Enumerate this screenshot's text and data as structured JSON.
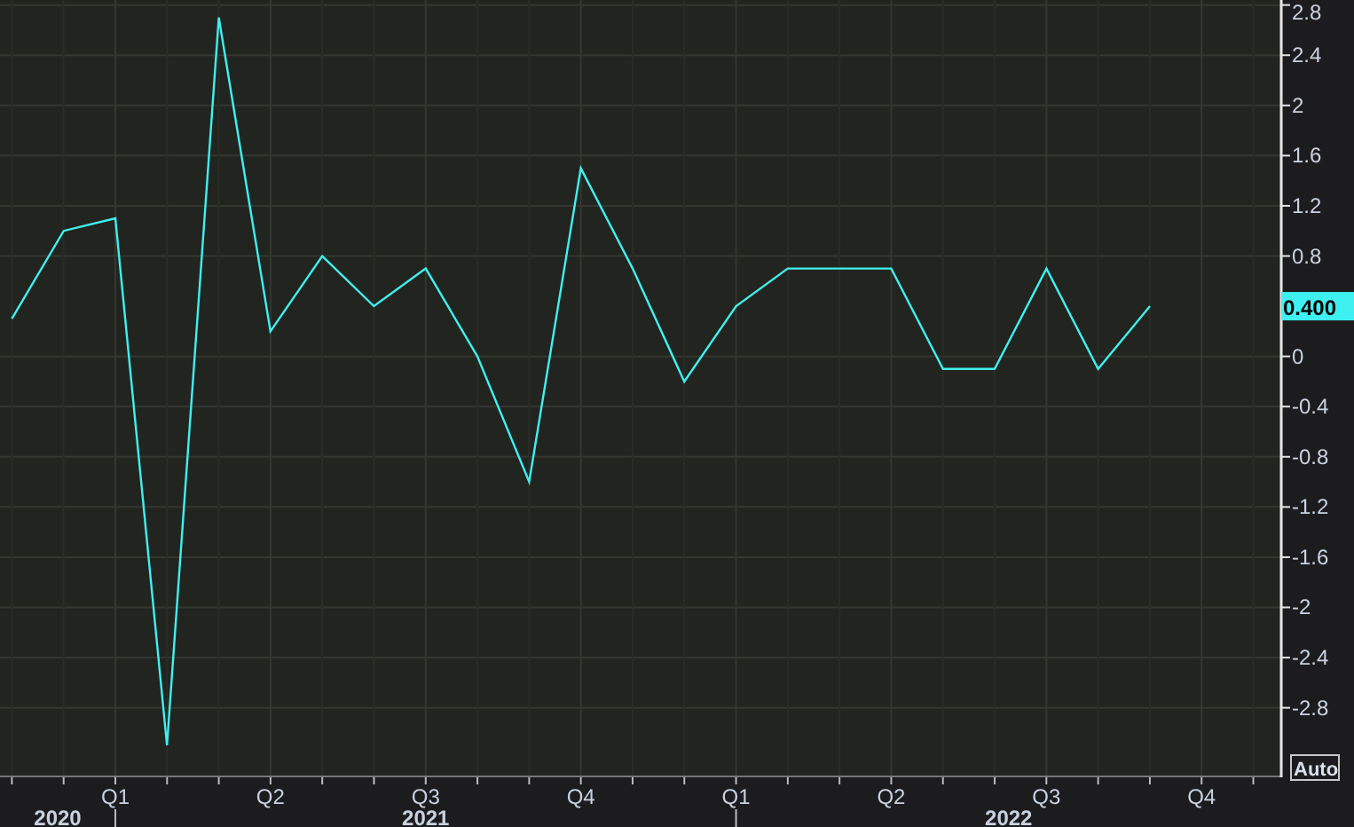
{
  "chart_data": {
    "type": "line",
    "categories": [
      null,
      null,
      "Q1",
      null,
      null,
      "Q2",
      null,
      null,
      "Q3",
      null,
      null,
      "Q4",
      null,
      null,
      "Q1",
      null,
      null,
      "Q2",
      null,
      null,
      "Q3",
      null,
      null,
      "Q4",
      null
    ],
    "series": [
      {
        "color": "#3ff0f0",
        "values": [
          0.3,
          1.0,
          1.1,
          -3.1,
          2.7,
          0.2,
          0.8,
          0.4,
          0.7,
          0.0,
          -1.0,
          1.5,
          0.7,
          -0.2,
          0.4,
          0.7,
          0.7,
          0.7,
          -0.1,
          -0.1,
          0.7,
          -0.1,
          0.4,
          null,
          null
        ]
      }
    ],
    "grid": true,
    "ylim": [
      -3.34,
      2.84
    ],
    "yticks": [
      {
        "value": 2.8,
        "label": "2.8"
      },
      {
        "value": 2.4,
        "label": "2.4"
      },
      {
        "value": 2,
        "label": "2"
      },
      {
        "value": 1.6,
        "label": "1.6"
      },
      {
        "value": 1.2,
        "label": "1.2"
      },
      {
        "value": 0.8,
        "label": "0.8"
      },
      {
        "value": 0,
        "label": "0"
      },
      {
        "value": -0.4,
        "label": "-0.4"
      },
      {
        "value": -0.8,
        "label": "-0.8"
      },
      {
        "value": -1.2,
        "label": "-1.2"
      },
      {
        "value": -1.6,
        "label": "-1.6"
      },
      {
        "value": -2,
        "label": "-2"
      },
      {
        "value": -2.4,
        "label": "-2.4"
      },
      {
        "value": -2.8,
        "label": "-2.8"
      }
    ]
  },
  "years": [
    {
      "label": "2020"
    },
    {
      "label": "2021"
    },
    {
      "label": "2022"
    }
  ],
  "current_value": {
    "label": "0.400"
  },
  "scale_button": {
    "label": "Auto"
  }
}
